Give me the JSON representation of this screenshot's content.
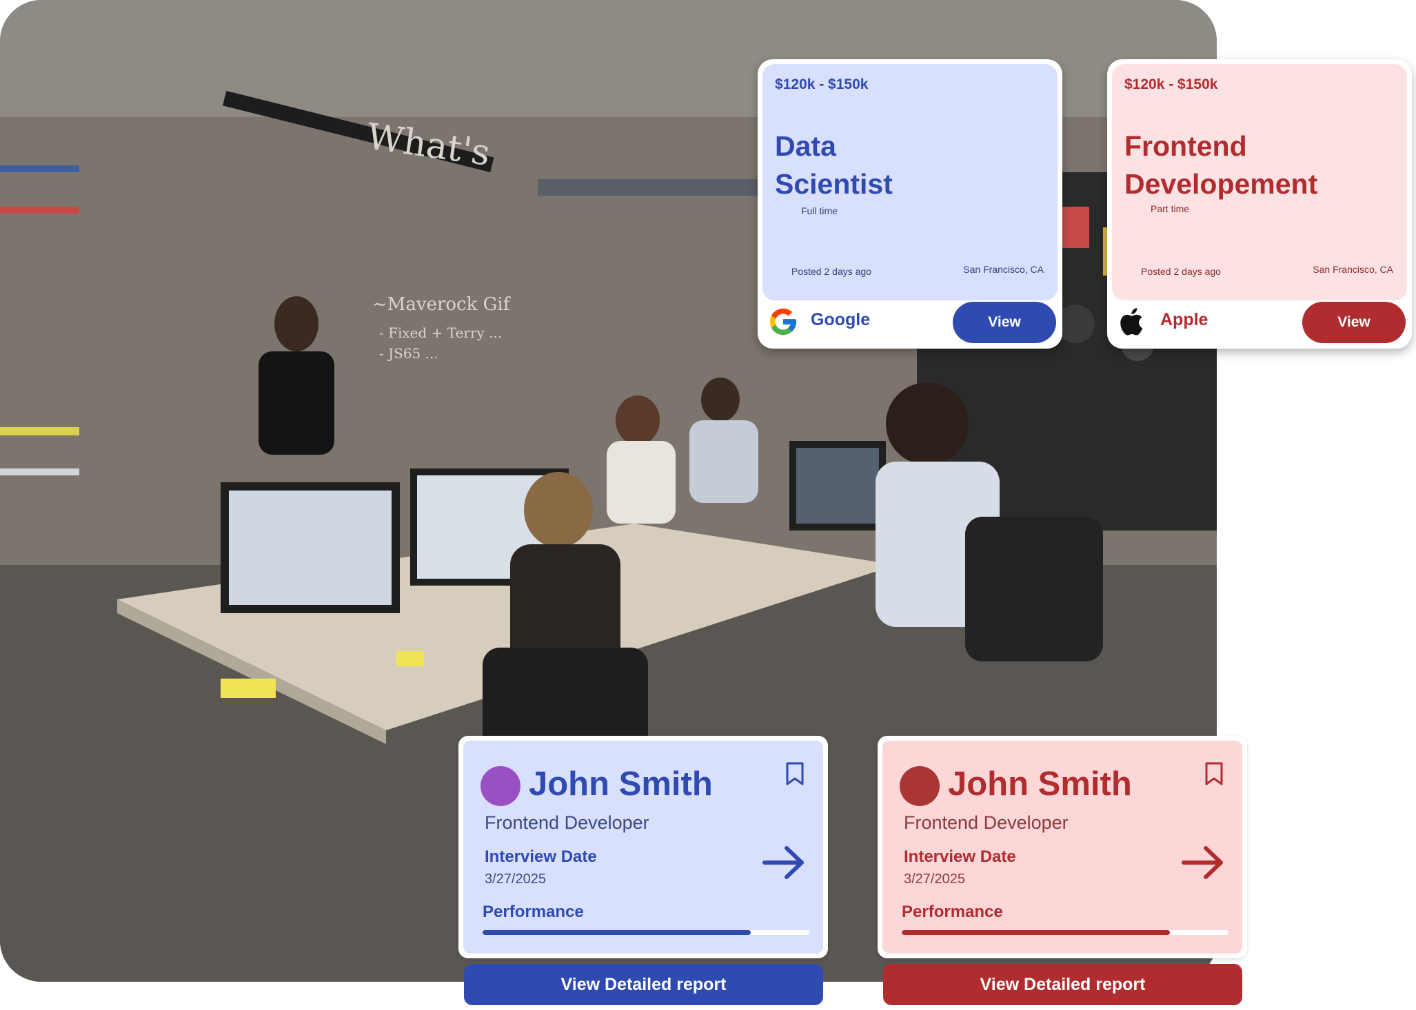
{
  "jobs": [
    {
      "salary": "$120k - $150k",
      "title_line1": "Data",
      "title_line2": "Scientist",
      "type": "Full time",
      "posted": "Posted 2 days ago",
      "location": "San Francisco, CA",
      "company": "Google",
      "logo_icon": "google-logo-icon",
      "view_label": "View",
      "accent": "#2f4ab1",
      "tint": "#d8e0fd"
    },
    {
      "salary": "$120k - $150k",
      "title_line1": "Frontend",
      "title_line2": "Developement",
      "type": "Part time",
      "posted": "Posted 2 days ago",
      "location": "San Francisco, CA",
      "company": "Apple",
      "logo_icon": "apple-logo-icon",
      "view_label": "View",
      "accent": "#b02c2f",
      "tint": "#fde2e3"
    }
  ],
  "candidates": [
    {
      "name": "John Smith",
      "role": "Frontend Developer",
      "interview_label": "Interview Date",
      "interview_date": "3/27/2025",
      "performance_label": "Performance",
      "performance": 0.82,
      "report_label": "View Detailed report",
      "avatar_color": "#9b4fc5",
      "accent": "#2f4ab1"
    },
    {
      "name": "John Smith",
      "role": "Frontend Developer",
      "interview_label": "Interview Date",
      "interview_date": "3/27/2025",
      "performance_label": "Performance",
      "performance": 0.82,
      "report_label": "View Detailed report",
      "avatar_color": "#aa3535",
      "accent": "#b02c2f"
    }
  ]
}
